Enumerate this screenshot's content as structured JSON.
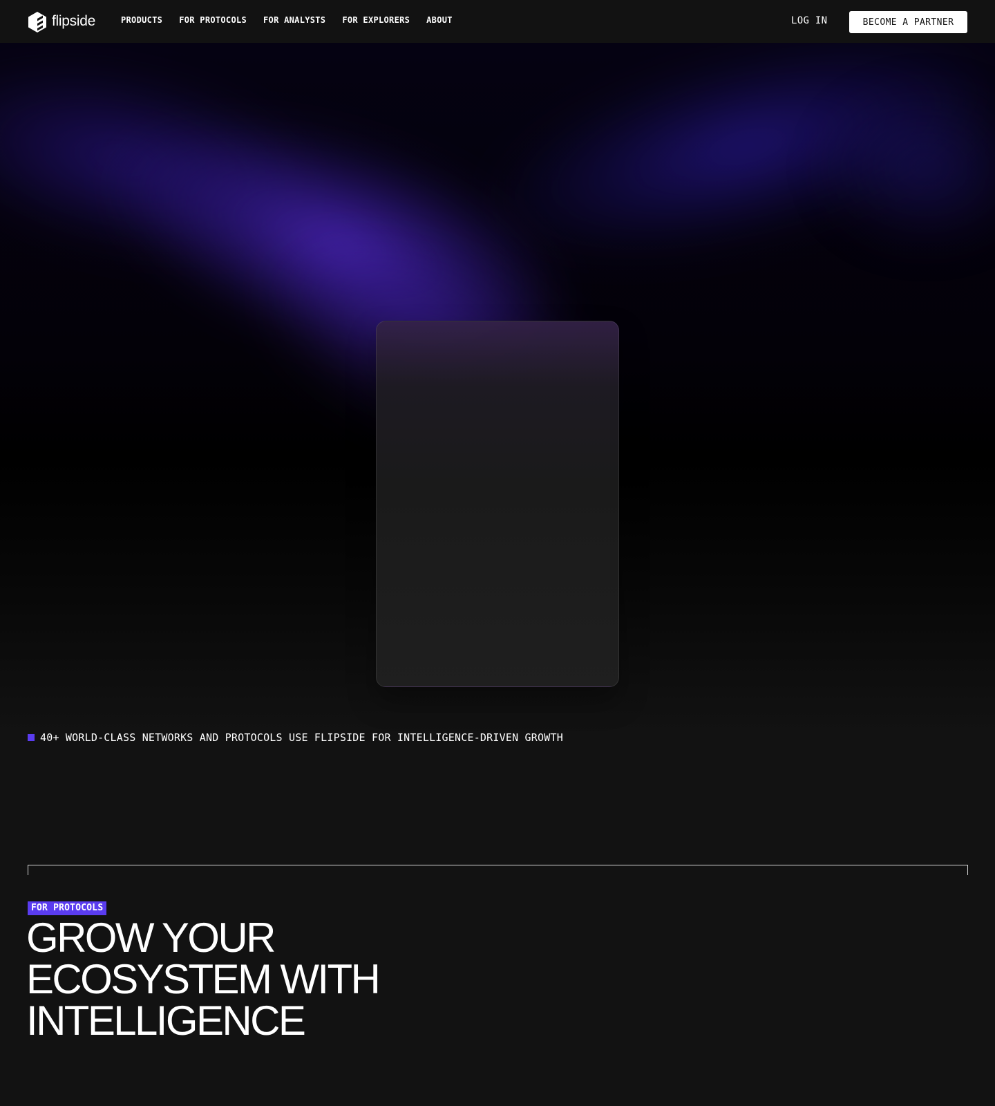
{
  "brand": {
    "name": "flipside",
    "logo_icon": "flipside-cube-logo-icon"
  },
  "nav": {
    "links": [
      "PRODUCTS",
      "FOR PROTOCOLS",
      "FOR ANALYSTS",
      "FOR EXPLORERS",
      "ABOUT"
    ],
    "login_label": "LOG IN",
    "partner_label": "BECOME A PARTNER"
  },
  "tagline": {
    "text": "40+ WORLD-CLASS NETWORKS AND PROTOCOLS USE FLIPSIDE FOR INTELLIGENCE-DRIVEN GROWTH"
  },
  "section": {
    "badge": "FOR PROTOCOLS",
    "title_lines": [
      "GROW YOUR",
      "ECOSYSTEM WITH",
      "INTELLIGENCE"
    ]
  },
  "colors": {
    "background": "#121212",
    "accent": "#5a3cf0",
    "text": "#ffffff",
    "button_bg": "#ffffff",
    "button_text": "#121212"
  }
}
